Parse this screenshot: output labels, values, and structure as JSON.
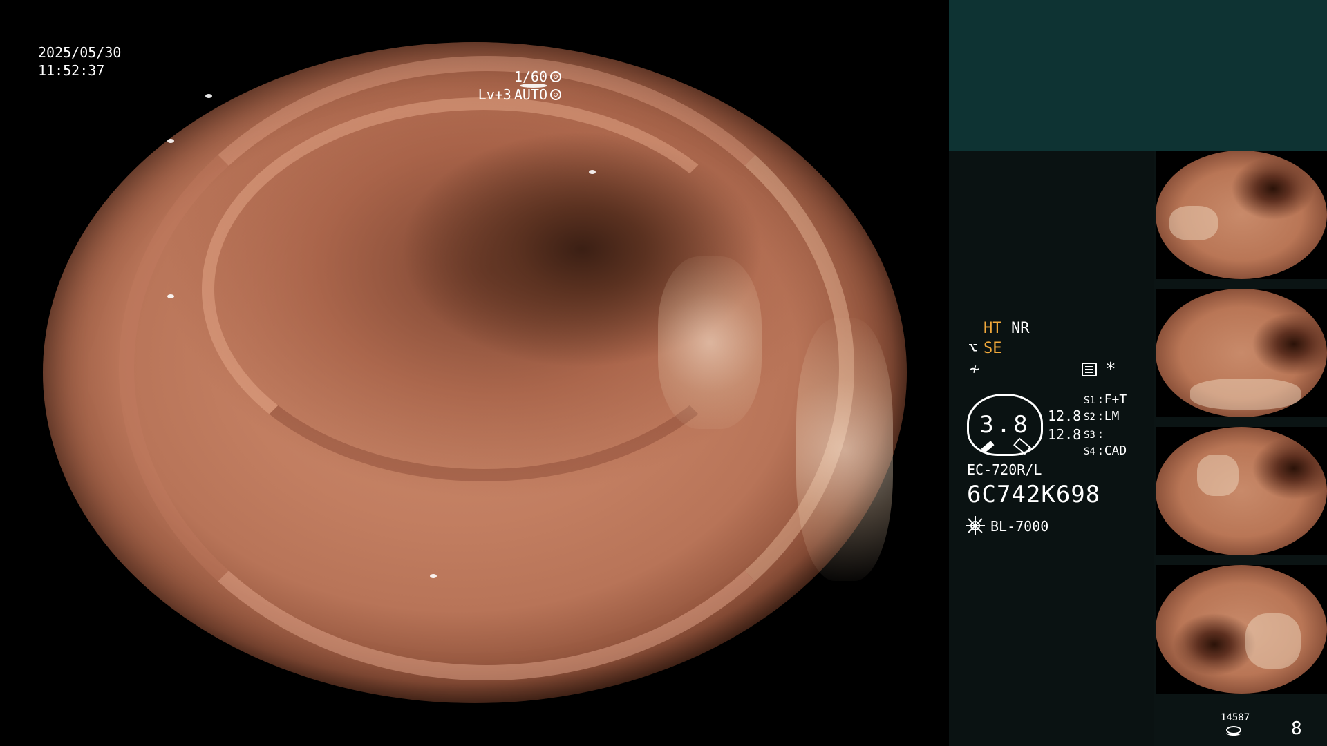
{
  "osd": {
    "date": "2025/05/30",
    "time": "11:52:37",
    "shutter": "1/60",
    "level": "Lv+3",
    "mode": "AUTO"
  },
  "status": {
    "ht": "HT",
    "nr": "NR",
    "se": "SE",
    "asterisk": "*",
    "gauge_value": "3.8",
    "value_1": "12.8",
    "value_2": "12.8",
    "switches": [
      {
        "key": "S1",
        "value": "F+T"
      },
      {
        "key": "S2",
        "value": "LM"
      },
      {
        "key": "S3",
        "value": ""
      },
      {
        "key": "S4",
        "value": "CAD"
      }
    ],
    "scope_model": "EC-720R/L",
    "serial": "6C742K698",
    "light_source": "BL-7000"
  },
  "footer": {
    "image_count": "14587",
    "page": "8"
  },
  "icons": [
    "shutter-icon",
    "auto-iris-icon",
    "scope-icon",
    "freeze-icon",
    "menu-icon",
    "light-source-icon",
    "disk-icon"
  ],
  "colors": {
    "accent_orange": "#f2a93b",
    "panel_top": "#0e3333",
    "panel": "#0a1212"
  }
}
